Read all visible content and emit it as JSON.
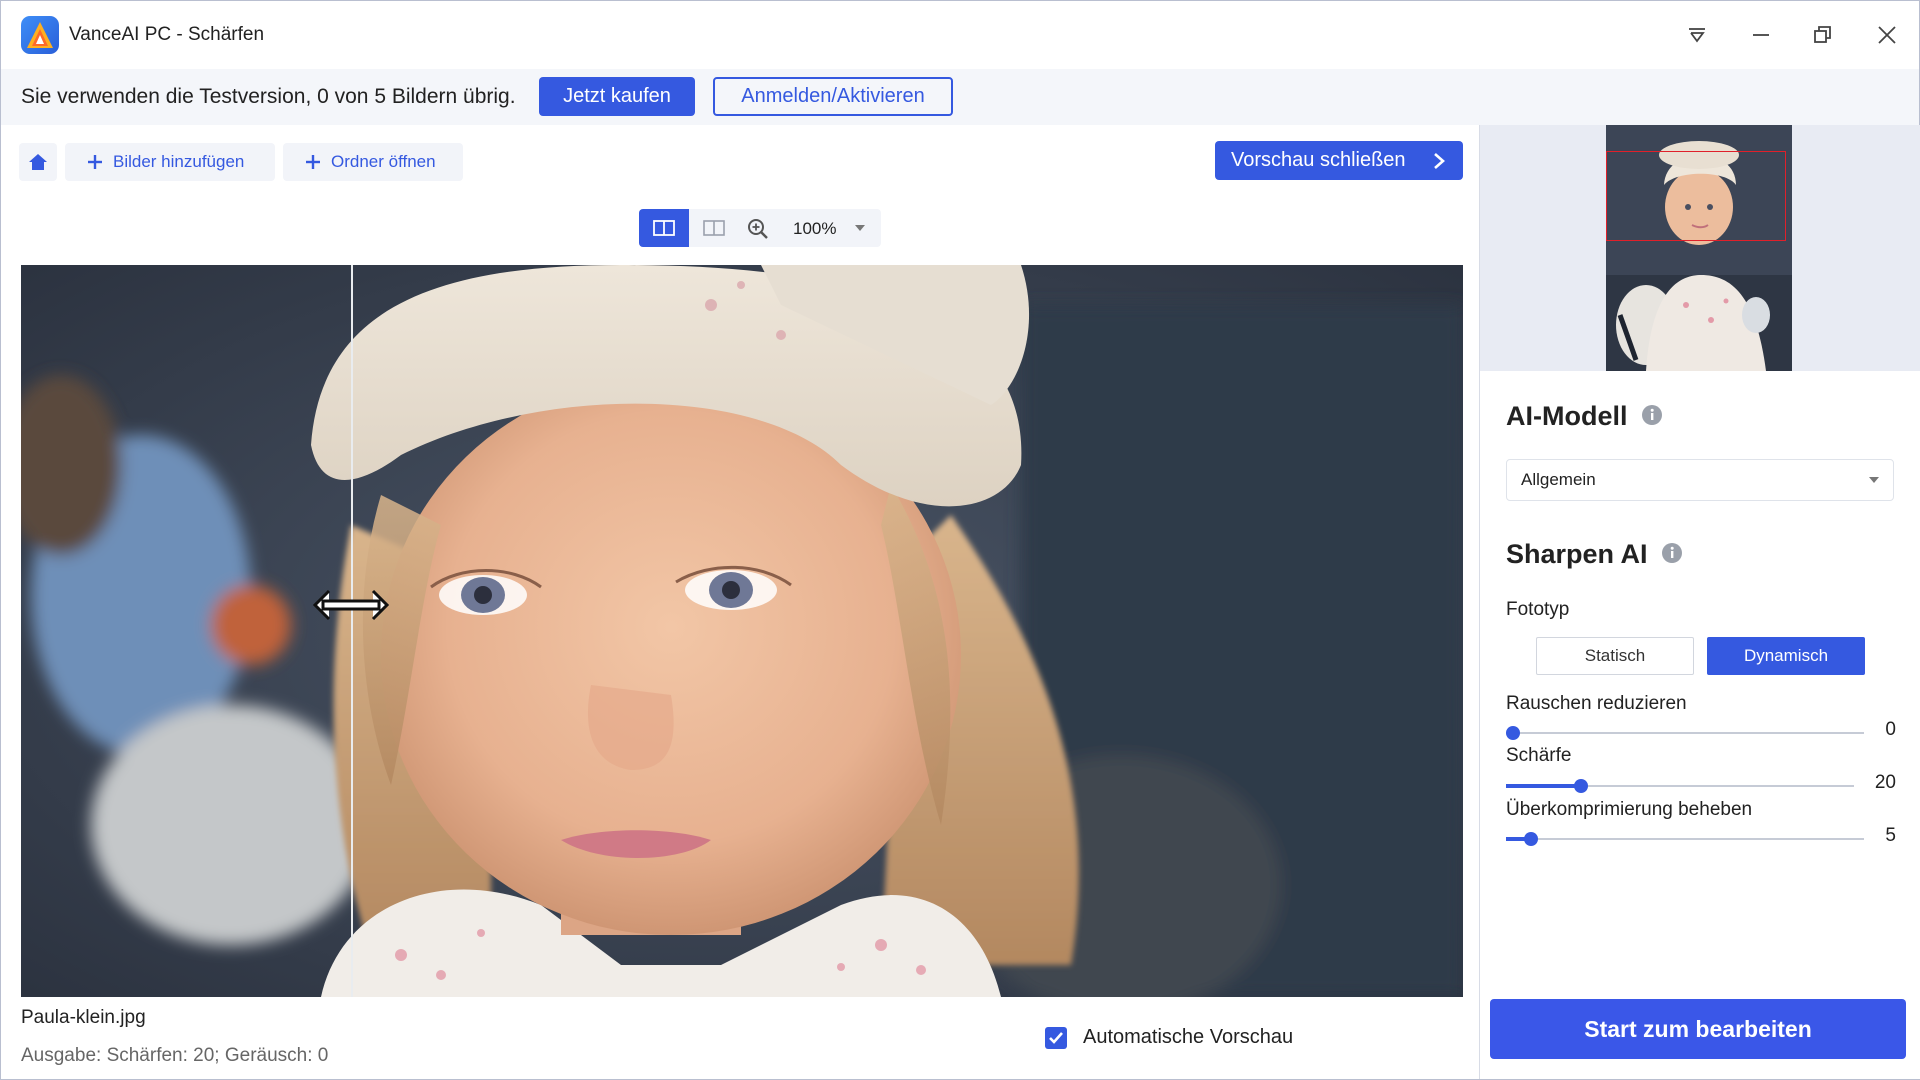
{
  "window": {
    "title": "VanceAI PC - Schärfen"
  },
  "trial": {
    "text": "Sie verwenden die Testversion, 0 von 5 Bildern übrig.",
    "buy_label": "Jetzt kaufen",
    "login_label": "Anmelden/Aktivieren"
  },
  "toolbar": {
    "add_images_label": "Bilder hinzufügen",
    "open_folder_label": "Ordner öffnen",
    "close_preview_label": "Vorschau schließen"
  },
  "viewbar": {
    "zoom": "100%"
  },
  "file": {
    "name": "Paula-klein.jpg",
    "output": "Ausgabe: Schärfen: 20; Geräusch: 0"
  },
  "auto_preview": {
    "label": "Automatische Vorschau",
    "checked": true
  },
  "panel": {
    "ai_model_title": "AI-Modell",
    "model_selected": "Allgemein",
    "sharpen_title": "Sharpen AI",
    "photo_type_label": "Fototyp",
    "photo_types": [
      "Statisch",
      "Dynamisch"
    ],
    "photo_type_selected": "Dynamisch",
    "sliders": [
      {
        "label": "Rauschen reduzieren",
        "value": "0"
      },
      {
        "label": "Schärfe",
        "value": "20"
      },
      {
        "label": "Überkomprimierung beheben",
        "value": "5"
      }
    ],
    "start_label": "Start zum bearbeiten"
  },
  "colors": {
    "accent": "#3559e0",
    "start_button": "#3a57e8",
    "preview_frame": "#e0202a"
  }
}
